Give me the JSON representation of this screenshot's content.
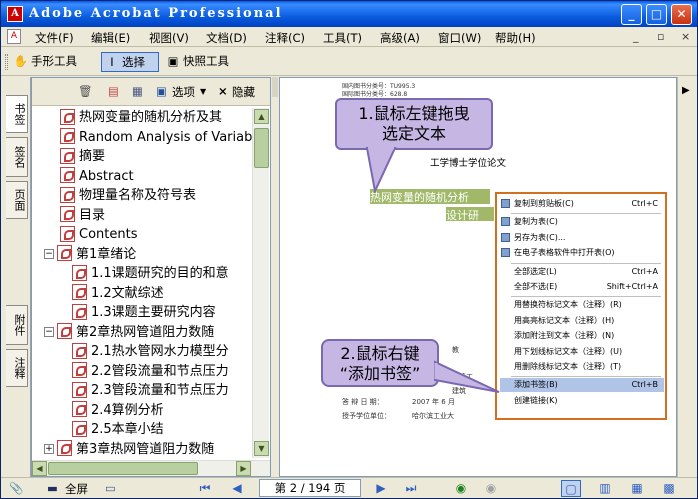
{
  "window": {
    "title": "Adobe Acrobat Professional",
    "app_icon": "A",
    "minimize": "_",
    "maximize": "□",
    "close": "✕"
  },
  "menu": {
    "items": [
      "文件(F)",
      "编辑(E)",
      "视图(V)",
      "文档(D)",
      "注释(C)",
      "工具(T)",
      "高级(A)",
      "窗口(W)",
      "帮助(H)"
    ],
    "right_controls": [
      "_",
      "▫",
      "×"
    ]
  },
  "toolbar": {
    "hand": "手形工具",
    "select": "选择",
    "snapshot": "快照工具"
  },
  "sidebar": {
    "tabs": [
      "书签",
      "签名",
      "页面",
      "附件",
      "注释"
    ],
    "header": {
      "options": "选项",
      "close": "隐藏"
    },
    "tree": [
      {
        "label": "热网变量的随机分析及其",
        "indent": 0,
        "toggle": ""
      },
      {
        "label": "Random Analysis of Variable",
        "indent": 0,
        "toggle": ""
      },
      {
        "label": "摘要",
        "indent": 0,
        "toggle": ""
      },
      {
        "label": "Abstract",
        "indent": 0,
        "toggle": ""
      },
      {
        "label": "物理量名称及符号表",
        "indent": 0,
        "toggle": ""
      },
      {
        "label": "目录",
        "indent": 0,
        "toggle": ""
      },
      {
        "label": "Contents",
        "indent": 0,
        "toggle": ""
      },
      {
        "label": "第1章绪论",
        "indent": 0,
        "toggle": "−"
      },
      {
        "label": "1.1课题研究的目的和意",
        "indent": 1,
        "toggle": ""
      },
      {
        "label": "1.2文献综述",
        "indent": 1,
        "toggle": ""
      },
      {
        "label": "1.3课题主要研究内容",
        "indent": 1,
        "toggle": ""
      },
      {
        "label": "第2章热网管道阻力数随",
        "indent": 0,
        "toggle": "−"
      },
      {
        "label": "2.1热水管网水力模型分",
        "indent": 1,
        "toggle": ""
      },
      {
        "label": "2.2管段流量和节点压力",
        "indent": 1,
        "toggle": ""
      },
      {
        "label": "2.3管段流量和节点压力",
        "indent": 1,
        "toggle": ""
      },
      {
        "label": "2.4算例分析",
        "indent": 1,
        "toggle": ""
      },
      {
        "label": "2.5本章小结",
        "indent": 1,
        "toggle": ""
      },
      {
        "label": "第3章热网管道阻力数随",
        "indent": 0,
        "toggle": "+"
      }
    ]
  },
  "document": {
    "meta_lines": [
      "国内图书分类号：TU995.3",
      "国际图书分类号：628.8"
    ],
    "thesis_type": "工学博士学位论文",
    "selected_title_line1": "热网变量的随机分析",
    "selected_title_line2": "设计研",
    "info_rows": [
      {
        "label": "答 辩 日 期：",
        "value": "2007 年 6 月"
      },
      {
        "label": "授予学位单位：",
        "value": "哈尔滨工业大"
      }
    ],
    "frag1": "教",
    "frag2": "环境工",
    "frag3": "建筑"
  },
  "context_menu": {
    "items": [
      {
        "label": "复制到剪贴板(C)",
        "key": "Ctrl+C",
        "sep_before": false,
        "highlight": false
      },
      {
        "label": "复制为表(C)",
        "key": "",
        "sep_before": true,
        "highlight": false
      },
      {
        "label": "另存为表(C)...",
        "key": "",
        "sep_before": false,
        "highlight": false
      },
      {
        "label": "在电子表格软件中打开表(O)",
        "key": "",
        "sep_before": false,
        "highlight": false
      },
      {
        "label": "全部选定(L)",
        "key": "Ctrl+A",
        "sep_before": true,
        "highlight": false
      },
      {
        "label": "全部不选(E)",
        "key": "Shift+Ctrl+A",
        "sep_before": false,
        "highlight": false
      },
      {
        "label": "用替换符标记文本（注释）(R)",
        "key": "",
        "sep_before": true,
        "highlight": false
      },
      {
        "label": "用高亮标记文本（注释）(H)",
        "key": "",
        "sep_before": false,
        "highlight": false
      },
      {
        "label": "添加附注到文本（注释）(N)",
        "key": "",
        "sep_before": false,
        "highlight": false
      },
      {
        "label": "用下划线标记文本（注释）(U)",
        "key": "",
        "sep_before": false,
        "highlight": false
      },
      {
        "label": "用删除线标记文本（注释）(T)",
        "key": "",
        "sep_before": false,
        "highlight": false
      },
      {
        "label": "添加书签(B)",
        "key": "Ctrl+B",
        "sep_before": true,
        "highlight": true
      },
      {
        "label": "创建链接(K)",
        "key": "",
        "sep_before": false,
        "highlight": false
      }
    ]
  },
  "callouts": {
    "top": {
      "line1": "1.鼠标左键拖曳",
      "line2": "选定文本"
    },
    "bottom": {
      "line1": "2.鼠标右键",
      "line2": "“添加书签”"
    }
  },
  "statusbar": {
    "fullscreen": "全屏",
    "page": "第 2 / 194 页",
    "page_current": 2,
    "page_total": 194
  }
}
